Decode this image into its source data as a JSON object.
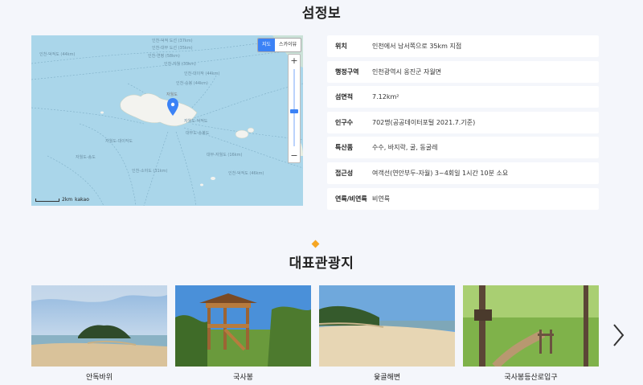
{
  "section1": {
    "title": "섬정보"
  },
  "map": {
    "type_buttons": [
      "지도",
      "스카이뷰"
    ],
    "active_type": "지도",
    "zoom_in": "+",
    "zoom_out": "−",
    "scale_label": "2km",
    "provider": "kakao",
    "labels": [
      "인천-덕적 도선 (37km)",
      "인천-대부 도선 (35km)",
      "인천-덕적도 (44km)",
      "인천-연평 (58km)",
      "인천-자월 (33km)",
      "인천-대이작 (44km)",
      "인천-승봉 (44km)",
      "자월도-대이작도",
      "자월도-덕적도",
      "대부도-승봉도",
      "자월도-송도",
      "인천-소야도 (31km)",
      "대부-자월도 (16km)",
      "인천-덕적도 (46km)",
      "자월도"
    ]
  },
  "info": {
    "rows": [
      {
        "key": "위치",
        "value": "인천에서 남서쪽으로 35km 지점"
      },
      {
        "key": "행정구역",
        "value": "인천광역시 옹진군 자월면"
      },
      {
        "key": "섬면적",
        "value": "7.12km²"
      },
      {
        "key": "인구수",
        "value": "702명(공공데이터포털 2021.7.기준)"
      },
      {
        "key": "특산품",
        "value": "수수, 바지락, 굴, 동굴레"
      },
      {
        "key": "접근성",
        "value": "여객선(연안부두-자월) 3~4회일 1시간 10분 소요"
      },
      {
        "key": "연륙/비연륙",
        "value": "비연륙"
      }
    ]
  },
  "section2": {
    "title": "대표관광지"
  },
  "attractions": [
    {
      "name": "안독바위"
    },
    {
      "name": "국사봉"
    },
    {
      "name": "윷골해변"
    },
    {
      "name": "국사봉등산로입구"
    }
  ],
  "next_icon": "chevron-right-icon",
  "colors": {
    "accent": "#3b82f6",
    "diamond": "#f5a623",
    "sea": "#aad6ea"
  }
}
